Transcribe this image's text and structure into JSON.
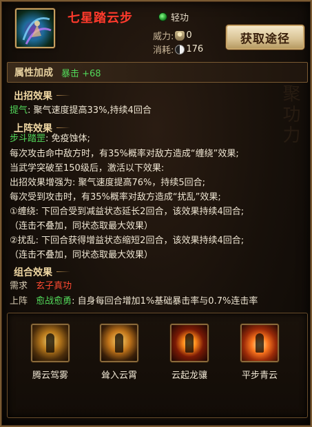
{
  "header": {
    "skill_name": "七星踏云步",
    "type_label": "轻功",
    "power_label": "威力:",
    "power_value": "0",
    "cost_label": "消耗:",
    "cost_value": "176",
    "acquire_button": "获取途径"
  },
  "attributes": {
    "title": "属性加成",
    "value": "暴击 +68"
  },
  "sections": {
    "chuzhao_title": "出招效果",
    "chuzhao_line": {
      "key": "提气",
      "text": ": 聚气速度提高33%,持续4回合"
    },
    "shangzhen_title": "上阵效果",
    "shangzhen_lines": [
      {
        "key": "步斗踏罡",
        "text": ": 免疫蚀体;"
      },
      {
        "key": "",
        "text": "每次攻击命中敌方时，有35%概率对敌方造成“缠绕”效果;"
      },
      {
        "key": "",
        "text": "当武学突破至150级后，激活以下效果:"
      },
      {
        "key": "",
        "text": "出招效果增强为: 聚气速度提高76%，持续5回合;"
      },
      {
        "key": "",
        "text": "每次受到攻击时，有35%概率对敌方造成“扰乱”效果;"
      },
      {
        "key": "",
        "text": "①缠绕: 下回合受到减益状态延长2回合，该效果持续4回合;"
      },
      {
        "key": "",
        "text": "（连击不叠加，同状态取最大效果）"
      },
      {
        "key": "",
        "text": "②扰乱: 下回合获得增益状态缩短2回合，该效果持续4回合;"
      },
      {
        "key": "",
        "text": "（连击不叠加，同状态取最大效果）"
      }
    ],
    "combo_title": "组合效果",
    "combo_need_label": "需求",
    "combo_need_value": "玄子真功",
    "combo_on_label": "上阵",
    "combo_on_name": "愈战愈勇",
    "combo_on_text": ": 自身每回合增加1%基础暴击率与0.7%连击率"
  },
  "combo_skills": [
    {
      "name": "腾云驾雾",
      "icon": "cloud-rider-icon"
    },
    {
      "name": "耸入云霄",
      "icon": "sky-soar-icon"
    },
    {
      "name": "云起龙骧",
      "icon": "dragon-rise-icon"
    },
    {
      "name": "平步青云",
      "icon": "ascend-icon"
    }
  ],
  "colors": {
    "name_red": "#ff3a2c",
    "effect_green": "#52d85a",
    "section_gold": "#efd7a3",
    "border_bronze": "#7a5a32"
  }
}
